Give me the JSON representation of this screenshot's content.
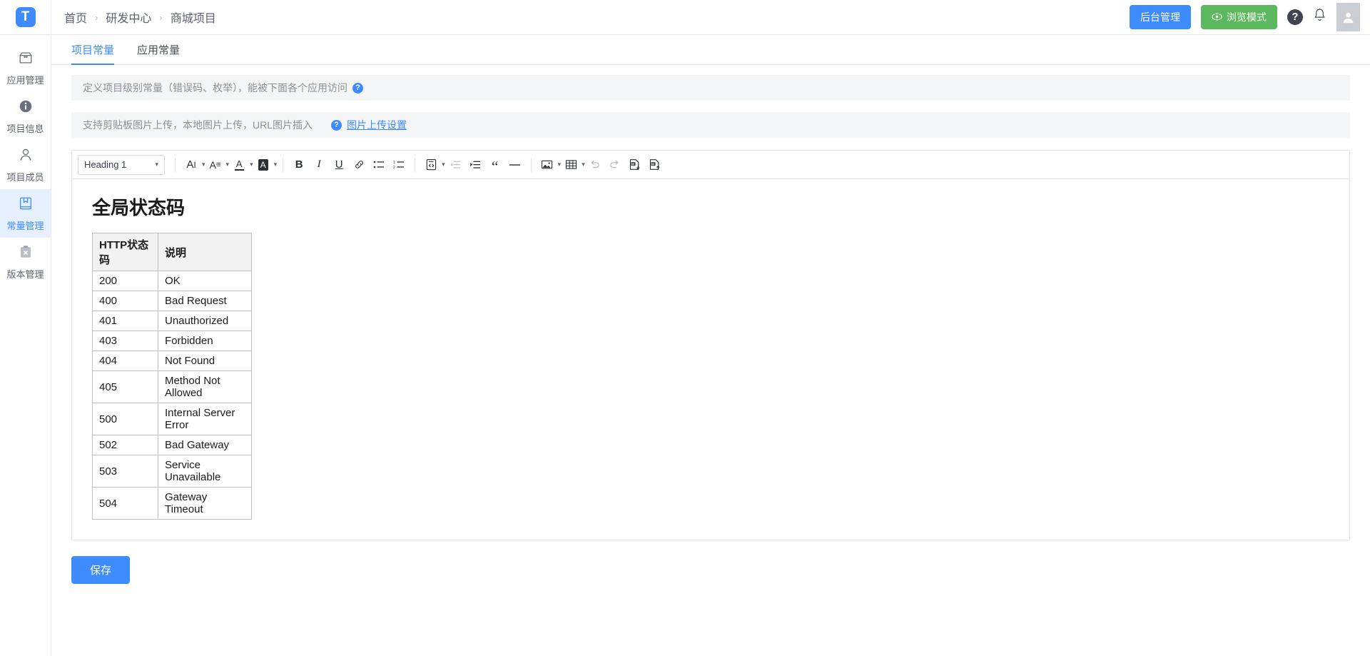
{
  "topbar": {
    "logo_text": "T",
    "logo_color": "#3d8bfd",
    "breadcrumb": [
      "首页",
      "研发中心",
      "商城项目"
    ],
    "separator": "›",
    "admin_button": "后台管理",
    "preview_button": "浏览模式",
    "help_icon": "question-mark-icon",
    "bell_icon": "notification-bell-icon",
    "avatar_icon": "user-avatar-icon"
  },
  "sidebar": {
    "items": [
      {
        "label": "应用管理",
        "icon": "box-icon",
        "active": false
      },
      {
        "label": "项目信息",
        "icon": "info-circle-icon",
        "active": false
      },
      {
        "label": "项目成员",
        "icon": "user-icon",
        "active": false
      },
      {
        "label": "常量管理",
        "icon": "book-icon",
        "active": true
      },
      {
        "label": "版本管理",
        "icon": "clipboard-x-icon",
        "active": false
      }
    ],
    "active_color": "#3d8bfd",
    "active_background": "#e5effd"
  },
  "tabs": [
    {
      "label": "项目常量",
      "active": true
    },
    {
      "label": "应用常量",
      "active": false
    }
  ],
  "notices": {
    "first": "定义项目级别常量（错误码、枚举），能被下面各个应用访问",
    "second": "支持剪贴板图片上传，本地图片上传，URL图片插入",
    "second_link": "图片上传设置"
  },
  "toolbar": {
    "heading_select": "Heading 1",
    "items": [
      {
        "name": "font-size-icon",
        "glyph": "AI",
        "dropdown": true,
        "dim": false
      },
      {
        "name": "line-height-icon",
        "glyph": "A≡",
        "dropdown": true,
        "dim": false
      },
      {
        "name": "text-color-icon",
        "glyph": "A",
        "dropdown": true,
        "dim": false
      },
      {
        "name": "background-color-icon",
        "glyph": "A",
        "dropdown": true,
        "dim": false
      },
      {
        "name": "bold-icon",
        "glyph": "B",
        "dropdown": false,
        "dim": false
      },
      {
        "name": "italic-icon",
        "glyph": "I",
        "dropdown": false,
        "dim": false
      },
      {
        "name": "underline-icon",
        "glyph": "U",
        "dropdown": false,
        "dim": false
      },
      {
        "name": "link-icon",
        "glyph": "🔗",
        "dropdown": false,
        "dim": false
      },
      {
        "name": "bullet-list-icon",
        "glyph": "•≡",
        "dropdown": false,
        "dim": false
      },
      {
        "name": "numbered-list-icon",
        "glyph": "1≡",
        "dropdown": false,
        "dim": false
      },
      {
        "name": "code-block-icon",
        "glyph": "</>",
        "dropdown": true,
        "dim": false
      },
      {
        "name": "outdent-icon",
        "glyph": "←≡",
        "dropdown": false,
        "dim": true
      },
      {
        "name": "indent-icon",
        "glyph": "→≡",
        "dropdown": false,
        "dim": false
      },
      {
        "name": "blockquote-icon",
        "glyph": "“",
        "dropdown": false,
        "dim": false
      },
      {
        "name": "horizontal-rule-icon",
        "glyph": "—",
        "dropdown": false,
        "dim": false
      },
      {
        "name": "insert-image-icon",
        "glyph": "🖼",
        "dropdown": true,
        "dim": false
      },
      {
        "name": "insert-table-icon",
        "glyph": "▦",
        "dropdown": true,
        "dim": false
      },
      {
        "name": "undo-icon",
        "glyph": "↩",
        "dropdown": false,
        "dim": true
      },
      {
        "name": "redo-icon",
        "glyph": "↪",
        "dropdown": false,
        "dim": true
      },
      {
        "name": "import-word-icon",
        "glyph": "W↓",
        "dropdown": false,
        "dim": false
      },
      {
        "name": "export-word-icon",
        "glyph": "W↑",
        "dropdown": false,
        "dim": false
      }
    ]
  },
  "document": {
    "heading": "全局状态码",
    "table": {
      "columns": [
        "HTTP状态码",
        "说明"
      ],
      "rows": [
        [
          "200",
          "OK"
        ],
        [
          "400",
          "Bad Request"
        ],
        [
          "401",
          "Unauthorized"
        ],
        [
          "403",
          "Forbidden"
        ],
        [
          "404",
          "Not Found"
        ],
        [
          "405",
          "Method Not Allowed"
        ],
        [
          "500",
          "Internal Server Error"
        ],
        [
          "502",
          "Bad Gateway"
        ],
        [
          "503",
          "Service Unavailable"
        ],
        [
          "504",
          "Gateway Timeout"
        ]
      ]
    }
  },
  "actions": {
    "save_label": "保存"
  }
}
